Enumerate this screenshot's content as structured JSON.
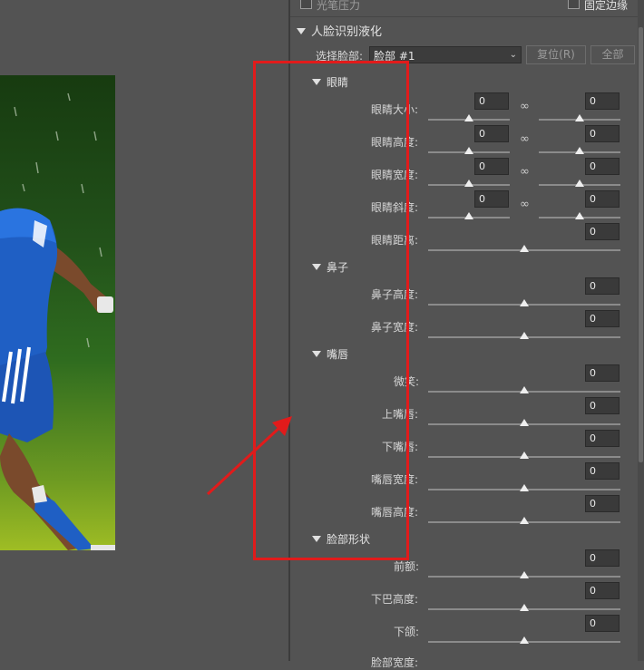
{
  "top_bar": {
    "pen_pressure_label": "光笔压力",
    "fix_edge_label": "固定边缘"
  },
  "face_liquify": {
    "title": "人脸识别液化",
    "select_face_label": "选择脸部:",
    "select_face_value": "脸部 #1",
    "reset_button": "复位(R)",
    "all_button": "全部"
  },
  "sections": {
    "eyes": {
      "title": "眼睛",
      "rows": [
        {
          "label": "眼睛大小:",
          "left": "0",
          "right": "0"
        },
        {
          "label": "眼睛高度:",
          "left": "0",
          "right": "0"
        },
        {
          "label": "眼睛宽度:",
          "left": "0",
          "right": "0"
        },
        {
          "label": "眼睛斜度:",
          "left": "0",
          "right": "0"
        },
        {
          "label": "眼睛距离:",
          "value": "0"
        }
      ]
    },
    "nose": {
      "title": "鼻子",
      "rows": [
        {
          "label": "鼻子高度:",
          "value": "0"
        },
        {
          "label": "鼻子宽度:",
          "value": "0"
        }
      ]
    },
    "mouth": {
      "title": "嘴唇",
      "rows": [
        {
          "label": "微笑:",
          "value": "0"
        },
        {
          "label": "上嘴唇:",
          "value": "0"
        },
        {
          "label": "下嘴唇:",
          "value": "0"
        },
        {
          "label": "嘴唇宽度:",
          "value": "0"
        },
        {
          "label": "嘴唇高度:",
          "value": "0"
        }
      ]
    },
    "face_shape": {
      "title": "脸部形状",
      "rows": [
        {
          "label": "前额:",
          "value": "0"
        },
        {
          "label": "下巴高度:",
          "value": "0"
        },
        {
          "label": "下颌:",
          "value": "0"
        },
        {
          "label": "脸部宽度:"
        }
      ]
    }
  },
  "colors": {
    "panel": "#535353",
    "annotation": "#e11b1b",
    "photo_jersey": "#1f5fc4"
  },
  "icons": {
    "link": "chain-link-icon",
    "collapse": "triangle-down-icon"
  }
}
